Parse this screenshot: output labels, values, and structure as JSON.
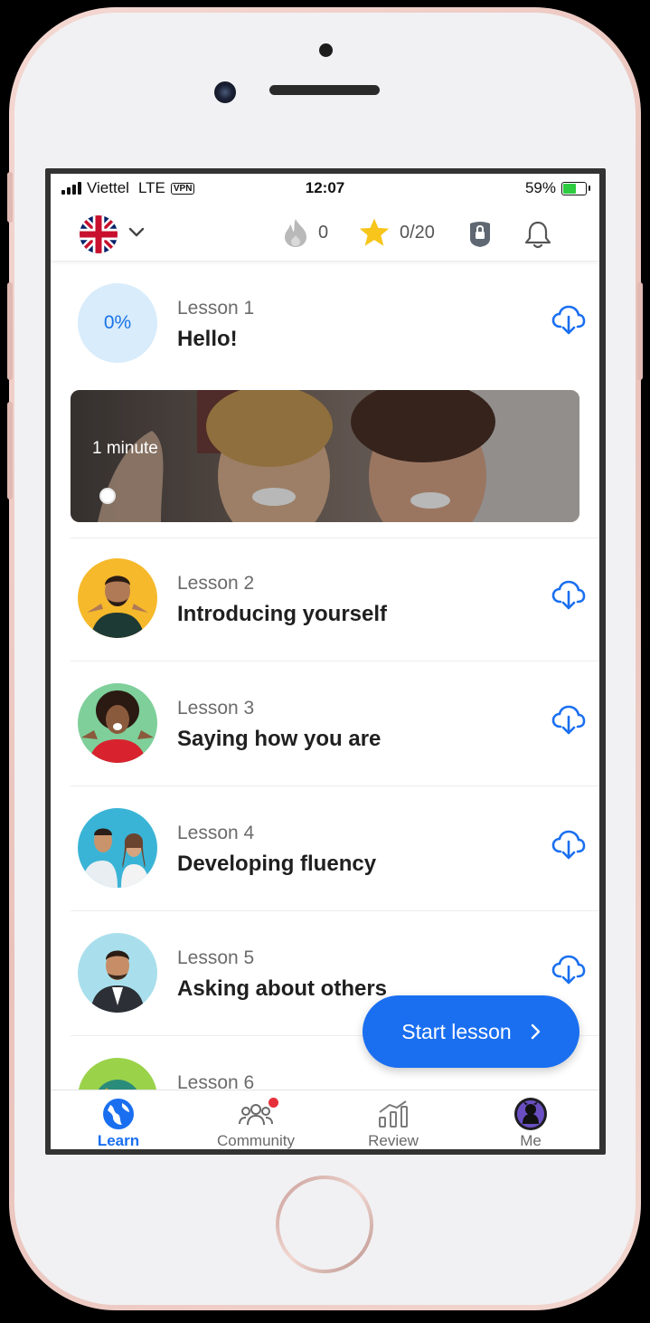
{
  "status_bar": {
    "carrier": "Viettel",
    "network": "LTE",
    "vpn": "VPN",
    "time": "12:07",
    "battery": "59%"
  },
  "top_bar": {
    "language_flag": "uk-flag-icon",
    "streak": "0",
    "stars": "0/20"
  },
  "lessons": [
    {
      "number": "Lesson 1",
      "title": "Hello!",
      "progress": "0%"
    },
    {
      "number": "Lesson 2",
      "title": "Introducing yourself"
    },
    {
      "number": "Lesson 3",
      "title": "Saying how you are"
    },
    {
      "number": "Lesson 4",
      "title": "Developing fluency"
    },
    {
      "number": "Lesson 5",
      "title": "Asking about others"
    },
    {
      "number": "Lesson 6",
      "title": ""
    }
  ],
  "banner": {
    "duration": "1 minute"
  },
  "start_button": {
    "label": "Start lesson"
  },
  "tabs": [
    {
      "label": "Learn",
      "icon": "globe-icon",
      "active": true
    },
    {
      "label": "Community",
      "icon": "people-icon",
      "badge": true
    },
    {
      "label": "Review",
      "icon": "chart-icon"
    },
    {
      "label": "Me",
      "icon": "avatar-icon"
    }
  ],
  "colors": {
    "accent": "#1a6ff0",
    "progress_bg": "#d8ecfb",
    "star": "#f7c51b"
  }
}
